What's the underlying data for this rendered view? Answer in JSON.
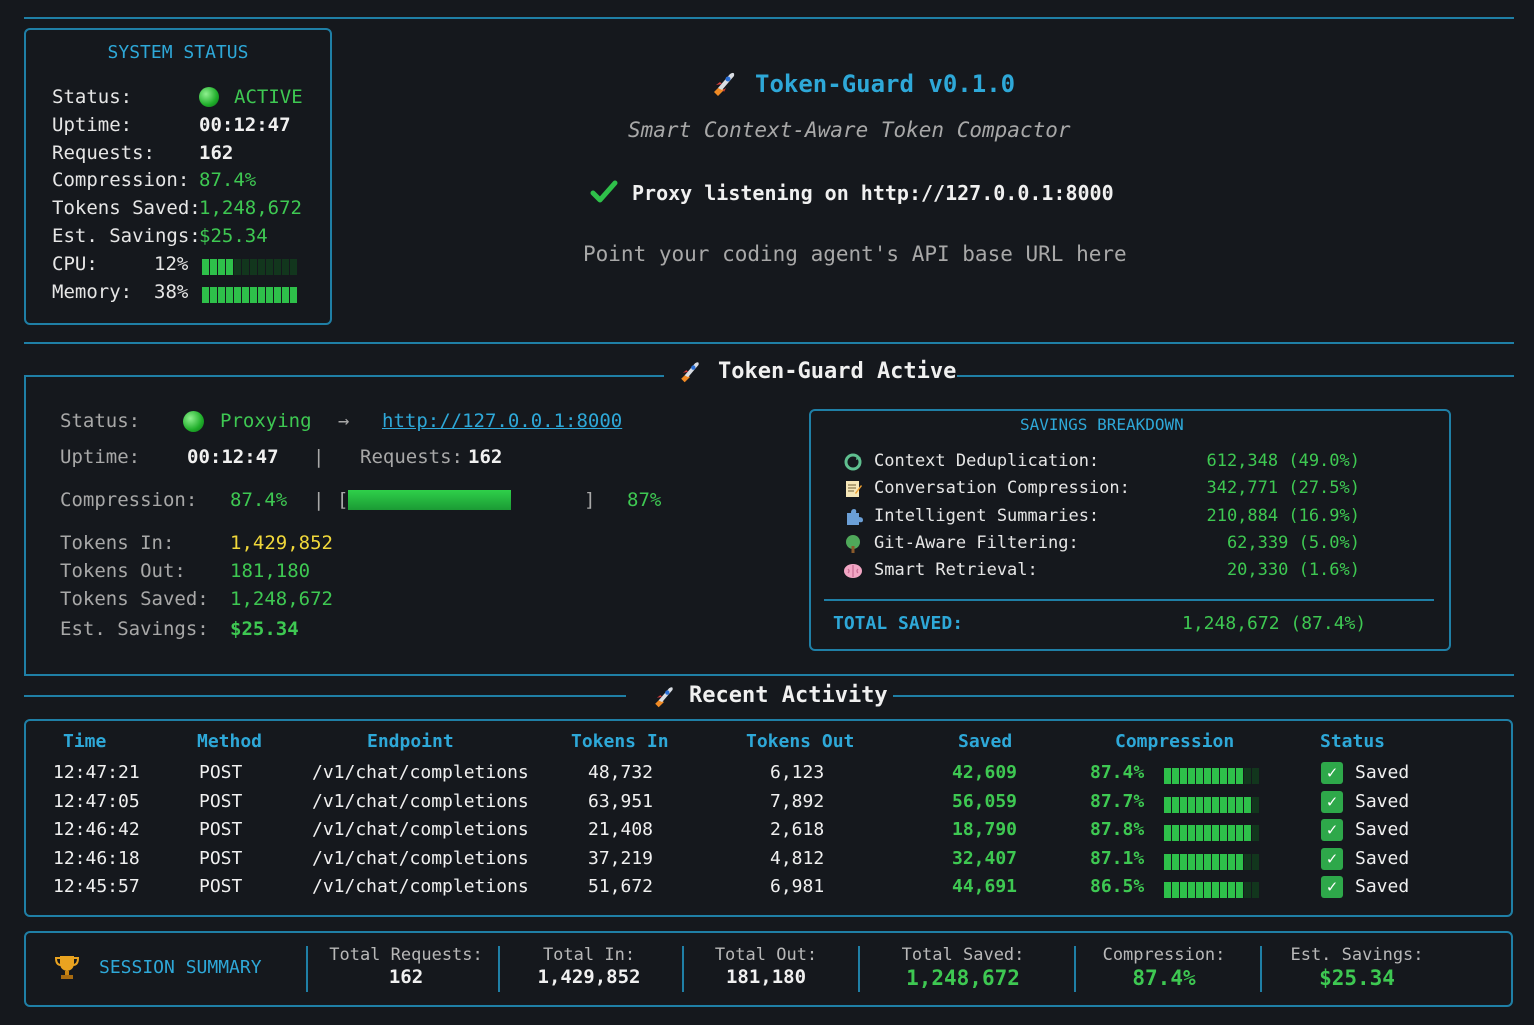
{
  "system_status": {
    "title": "SYSTEM STATUS",
    "rows": {
      "status_label": "Status:",
      "status_value": "ACTIVE",
      "uptime_label": "Uptime:",
      "uptime_value": "00:12:47",
      "requests_label": "Requests:",
      "requests_value": "162",
      "compression_label": "Compression:",
      "compression_value": "87.4%",
      "tokens_saved_label": "Tokens Saved:",
      "tokens_saved_value": "1,248,672",
      "est_savings_label": "Est. Savings:",
      "est_savings_value": "$25.34",
      "cpu_label": "CPU:",
      "cpu_value": "12%",
      "cpu_fraction": 0.12,
      "memory_label": "Memory:",
      "memory_value": "38%",
      "memory_fraction": 0.38
    }
  },
  "header": {
    "title": "Token-Guard v0.1.0",
    "subtitle": "Smart Context-Aware Token Compactor",
    "proxy_text": "Proxy listening on http://127.0.0.1:8000",
    "hint": "Point your coding agent's API base URL here",
    "rocket_icon": "rocket-icon",
    "check_icon": "check-icon"
  },
  "active_panel": {
    "title": "Token-Guard Active",
    "status_label": "Status:",
    "status_value": "Proxying",
    "arrow": "→",
    "url": "http://127.0.0.1:8000",
    "uptime_label": "Uptime:",
    "uptime_value": "00:12:47",
    "separator": "|",
    "requests_label": "Requests:",
    "requests_value": "162",
    "compression_label": "Compression:",
    "compression_value": "87.4%",
    "compression_pipe": "|",
    "compression_bar_open": "[",
    "compression_bar_close": "]",
    "compression_fraction": 0.874,
    "compression_percent": "87%",
    "tokens_in_label": "Tokens In:",
    "tokens_in_value": "1,429,852",
    "tokens_out_label": "Tokens Out:",
    "tokens_out_value": "181,180",
    "tokens_saved_label": "Tokens Saved:",
    "tokens_saved_value": "1,248,672",
    "est_savings_label": "Est. Savings:",
    "est_savings_value": "$25.34"
  },
  "savings_breakdown": {
    "title": "SAVINGS BREAKDOWN",
    "items": [
      {
        "icon": "recycle-icon",
        "label": "Context Deduplication:",
        "value": "612,348 (49.0%)"
      },
      {
        "icon": "memo-icon",
        "label": "Conversation Compression:",
        "value": "342,771 (27.5%)"
      },
      {
        "icon": "puzzle-icon",
        "label": "Intelligent Summaries:",
        "value": "210,884 (16.9%)"
      },
      {
        "icon": "tree-icon",
        "label": "Git-Aware Filtering:",
        "value": "62,339 (5.0%)"
      },
      {
        "icon": "brain-icon",
        "label": "Smart Retrieval:",
        "value": "20,330 (1.6%)"
      }
    ],
    "total_label": "TOTAL SAVED:",
    "total_value": "1,248,672 (87.4%)"
  },
  "recent_activity": {
    "title": "Recent Activity",
    "columns": [
      "Time",
      "Method",
      "Endpoint",
      "Tokens In",
      "Tokens Out",
      "Saved",
      "Compression",
      "Status"
    ],
    "rows": [
      {
        "time": "12:47:21",
        "method": "POST",
        "endpoint": "/v1/chat/completions",
        "tokens_in": "48,732",
        "tokens_out": "6,123",
        "saved": "42,609",
        "compression": "87.4%",
        "compression_fraction": 0.874,
        "status": "Saved"
      },
      {
        "time": "12:47:05",
        "method": "POST",
        "endpoint": "/v1/chat/completions",
        "tokens_in": "63,951",
        "tokens_out": "7,892",
        "saved": "56,059",
        "compression": "87.7%",
        "compression_fraction": 0.877,
        "status": "Saved"
      },
      {
        "time": "12:46:42",
        "method": "POST",
        "endpoint": "/v1/chat/completions",
        "tokens_in": "21,408",
        "tokens_out": "2,618",
        "saved": "18,790",
        "compression": "87.8%",
        "compression_fraction": 0.878,
        "status": "Saved"
      },
      {
        "time": "12:46:18",
        "method": "POST",
        "endpoint": "/v1/chat/completions",
        "tokens_in": "37,219",
        "tokens_out": "4,812",
        "saved": "32,407",
        "compression": "87.1%",
        "compression_fraction": 0.871,
        "status": "Saved"
      },
      {
        "time": "12:45:57",
        "method": "POST",
        "endpoint": "/v1/chat/completions",
        "tokens_in": "51,672",
        "tokens_out": "6,981",
        "saved": "44,691",
        "compression": "86.5%",
        "compression_fraction": 0.865,
        "status": "Saved"
      }
    ]
  },
  "session_summary": {
    "title": "SESSION SUMMARY",
    "icon": "trophy-icon",
    "cells": [
      {
        "label": "Total Requests:",
        "value": "162"
      },
      {
        "label": "Total In:",
        "value": "1,429,852"
      },
      {
        "label": "Total Out:",
        "value": "181,180"
      },
      {
        "label": "Total Saved:",
        "value": "1,248,672"
      },
      {
        "label": "Compression:",
        "value": "87.4%"
      },
      {
        "label": "Est. Savings:",
        "value": "$25.34"
      }
    ]
  },
  "colors": {
    "background": "#15181d",
    "accent_cyan": "#2ea8d8",
    "border": "#1f7fa6",
    "green": "#3ec852",
    "yellow": "#f1d83a"
  }
}
